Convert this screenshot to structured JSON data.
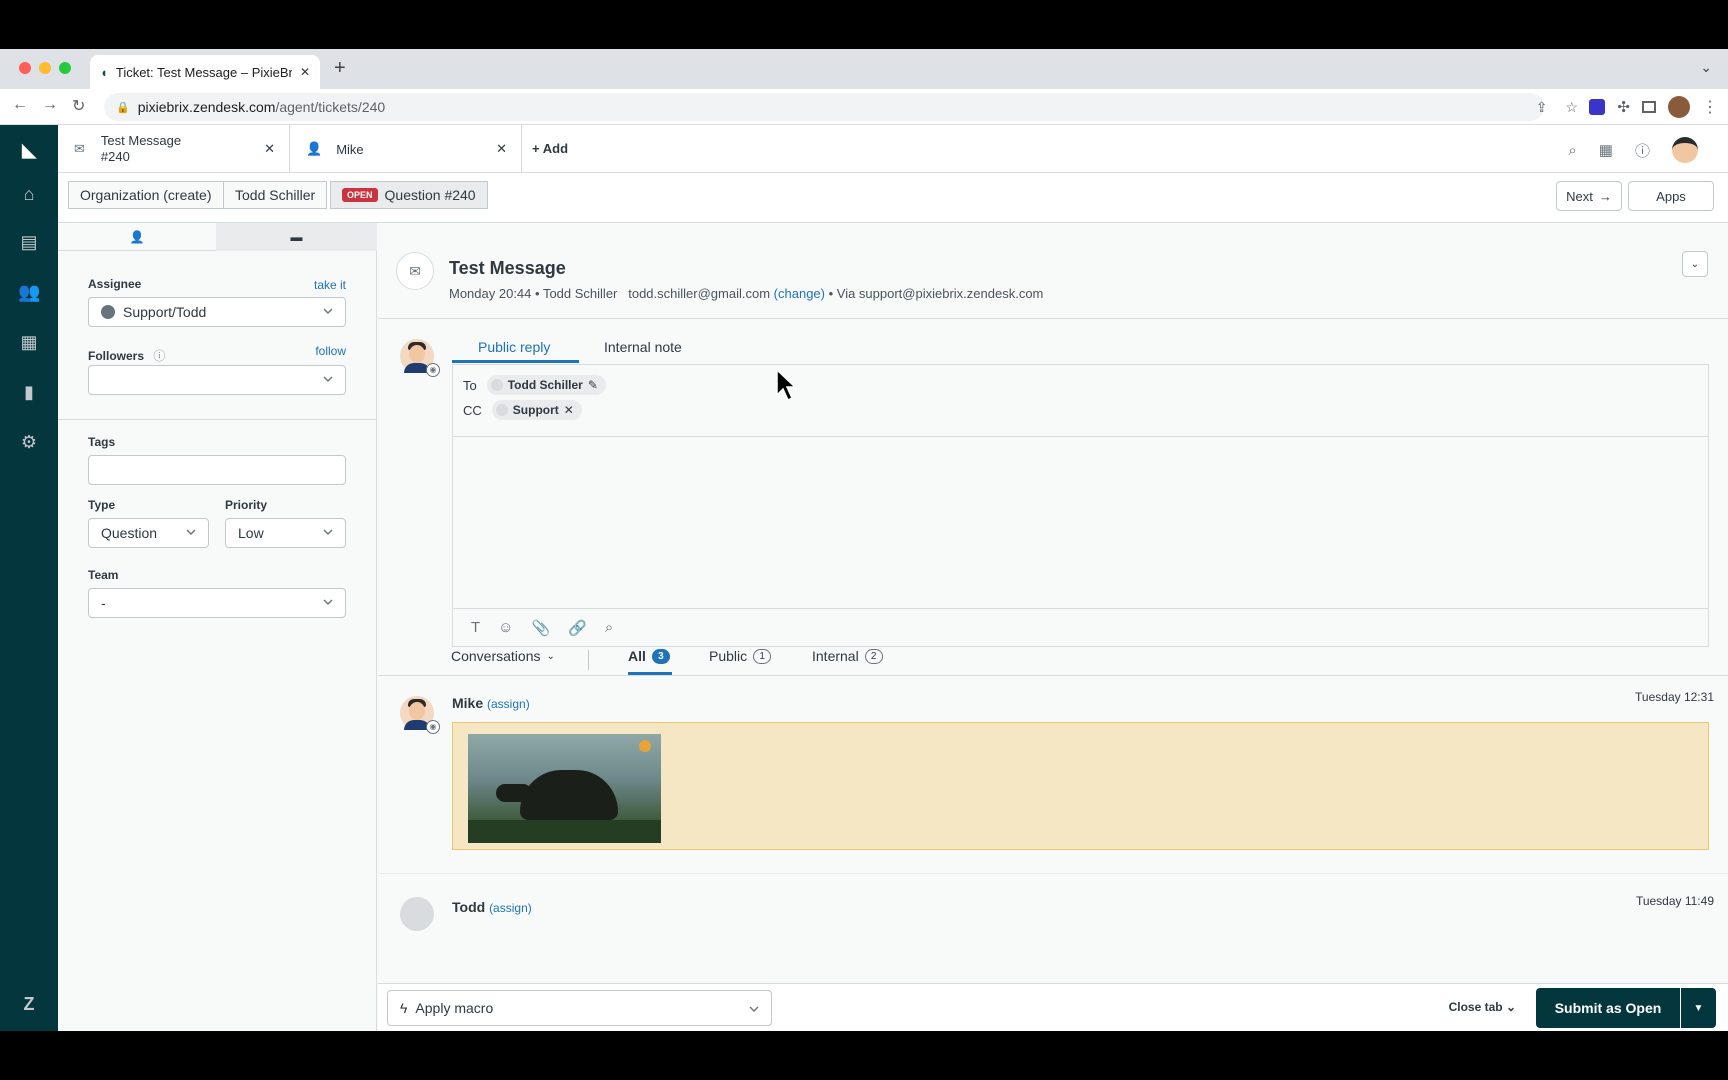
{
  "browser": {
    "tab_title": "Ticket: Test Message – PixieBrix",
    "url_host": "pixiebrix.zendesk.com",
    "url_path": "/agent/tickets/240"
  },
  "zd_tabs": [
    {
      "line1": "Test Message",
      "line2": "#240"
    },
    {
      "line1": "Mike"
    }
  ],
  "add_tab_label": "Add",
  "crumbs": {
    "org": "Organization (create)",
    "requester": "Todd Schiller",
    "status_badge": "OPEN",
    "ticket": "Question #240"
  },
  "nav": {
    "next": "Next",
    "apps": "Apps"
  },
  "sidebar": {
    "assignee_label": "Assignee",
    "take_it": "take it",
    "assignee_value": "Support/Todd",
    "followers_label": "Followers",
    "follow": "follow",
    "tags_label": "Tags",
    "type_label": "Type",
    "type_value": "Question",
    "priority_label": "Priority",
    "priority_value": "Low",
    "team_label": "Team",
    "team_value": "-"
  },
  "ticket": {
    "subject": "Test Message",
    "time": "Monday 20:44",
    "requester": "Todd Schiller",
    "email": "todd.schiller@gmail.com",
    "change": "(change)",
    "via": "Via support@pixiebrix.zendesk.com"
  },
  "composer": {
    "public_reply": "Public reply",
    "internal_note": "Internal note",
    "to_label": "To",
    "to_chip": "Todd Schiller",
    "cc_label": "CC",
    "cc_chip": "Support"
  },
  "conversations": {
    "filter_label": "Conversations",
    "all_label": "All",
    "all_count": "3",
    "public_label": "Public",
    "public_count": "1",
    "internal_label": "Internal",
    "internal_count": "2"
  },
  "messages": [
    {
      "author": "Mike",
      "assign": "(assign)",
      "time": "Tuesday 12:31"
    },
    {
      "author": "Todd",
      "assign": "(assign)",
      "time": "Tuesday 11:49"
    }
  ],
  "footer": {
    "macro": "Apply macro",
    "close_tab": "Close tab",
    "submit": "Submit as Open"
  },
  "colors": {
    "brand": "#03363d",
    "link": "#1f73b7",
    "open_badge": "#cc3340"
  }
}
